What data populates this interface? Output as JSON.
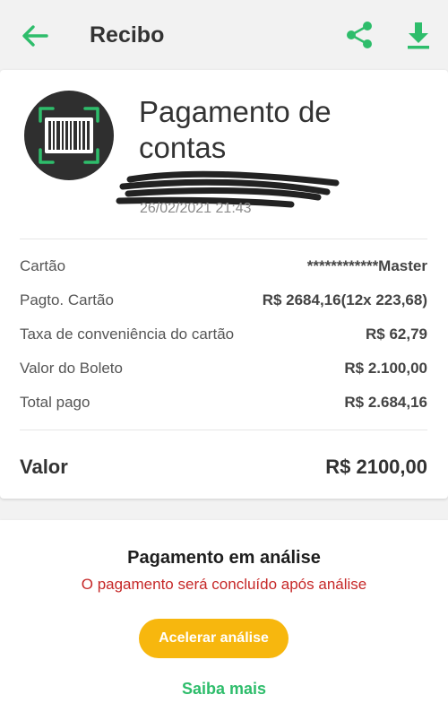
{
  "appbar": {
    "title": "Recibo"
  },
  "receipt": {
    "heading": "Pagamento de contas",
    "datetime": "26/02/2021 21:43",
    "rows": [
      {
        "label": "Cartão",
        "value": "************Master"
      },
      {
        "label": "Pagto. Cartão",
        "value": "R$ 2684,16(12x 223,68)"
      },
      {
        "label": "Taxa de conveniência do cartão",
        "value": "R$ 62,79"
      },
      {
        "label": "Valor do Boleto",
        "value": "R$ 2.100,00"
      },
      {
        "label": "Total pago",
        "value": "R$ 2.684,16"
      }
    ],
    "total": {
      "label": "Valor",
      "value": "R$ 2100,00"
    }
  },
  "status": {
    "title": "Pagamento em análise",
    "message": "O pagamento será concluído após análise",
    "accelerate_label": "Acelerar análise",
    "learn_more_label": "Saiba mais"
  },
  "colors": {
    "accent_green": "#2ebd6b",
    "button_yellow": "#f7b70e",
    "warning_red": "#c62828"
  },
  "icons": [
    "back-arrow-icon",
    "share-icon",
    "download-icon",
    "barcode-icon"
  ]
}
